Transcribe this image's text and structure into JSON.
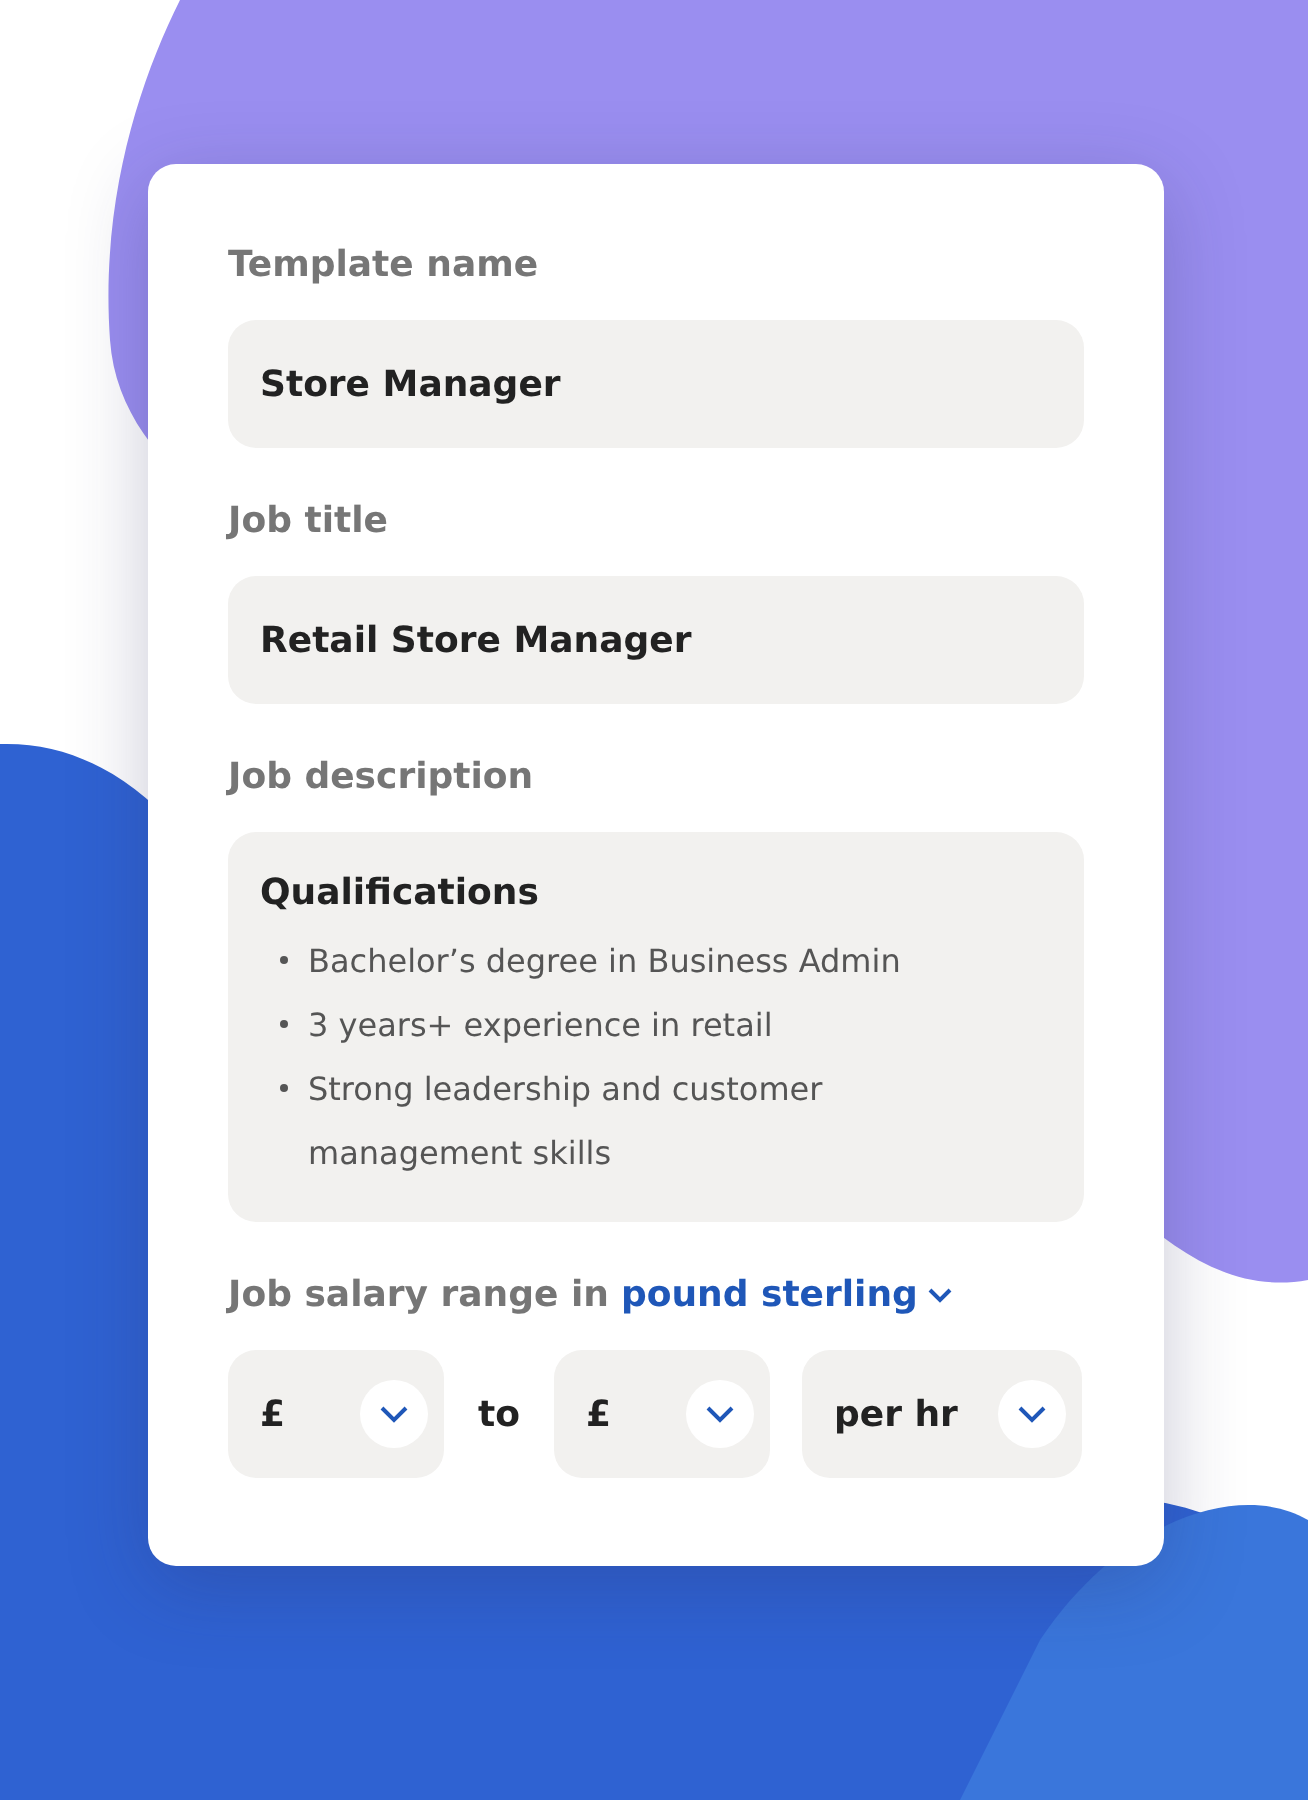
{
  "fields": [
    {
      "label": "Template name",
      "value": "Store Manager"
    },
    {
      "label": "Job title",
      "value": "Retail Store Manager"
    }
  ],
  "description": {
    "label": "Job description",
    "heading": "Qualifications",
    "bullets": [
      "Bachelor’s degree in Business Admin",
      "3 years+ experience in retail",
      "Strong leadership and customer management skills"
    ]
  },
  "salary": {
    "label": "Job salary range in",
    "currency": "pound sterling",
    "from": "£",
    "separator": "to",
    "to": "£",
    "period": "per hr"
  }
}
